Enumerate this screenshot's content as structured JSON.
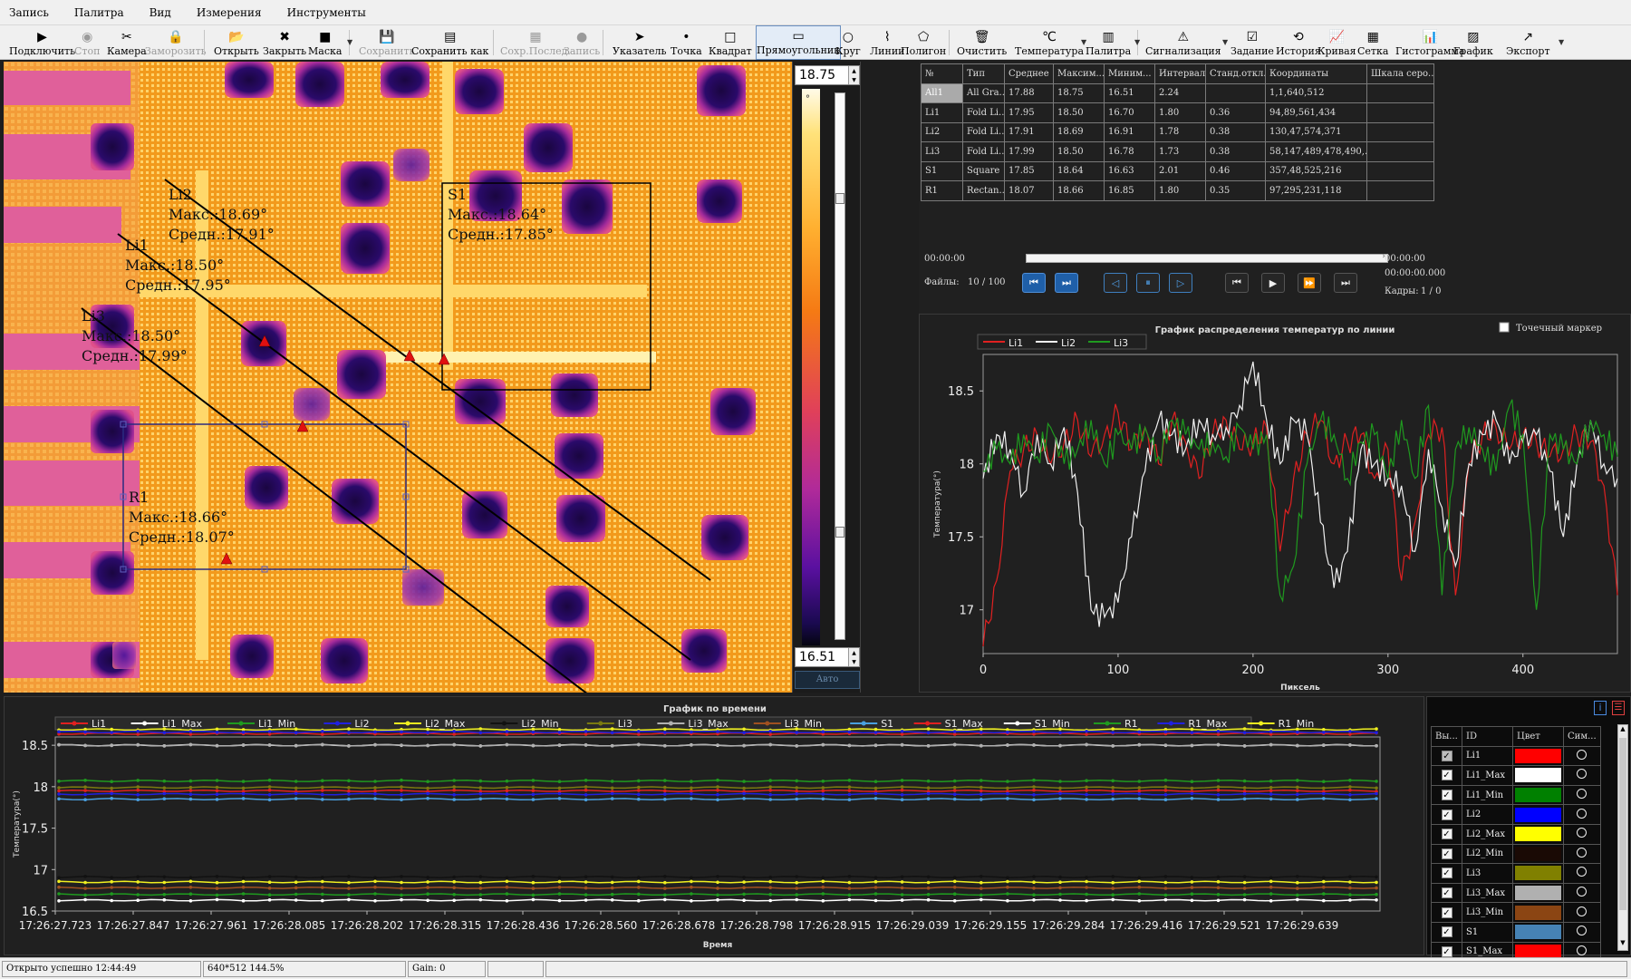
{
  "menu": [
    "Запись",
    "Палитра",
    "Вид",
    "Измерения",
    "Инструменты"
  ],
  "toolbar": [
    {
      "label": "Подключить",
      "icon": "play-icon",
      "glyph": "▶",
      "disabled": false
    },
    {
      "label": "Стоп",
      "icon": "stop-icon",
      "glyph": "◉",
      "disabled": true
    },
    {
      "label": "Камера",
      "icon": "camera-tools-icon",
      "glyph": "✂",
      "disabled": false
    },
    {
      "label": "Заморозить",
      "icon": "lock-icon",
      "glyph": "🔒",
      "disabled": true
    },
    {
      "label": "Открыть",
      "icon": "folder-icon",
      "glyph": "📂",
      "disabled": false
    },
    {
      "label": "Закрыть",
      "icon": "close-circle-icon",
      "glyph": "✖",
      "disabled": false
    },
    {
      "label": "Маска",
      "icon": "mask-icon",
      "glyph": "■",
      "disabled": false
    },
    {
      "label": "Сохранить",
      "icon": "save-icon",
      "glyph": "💾",
      "disabled": true
    },
    {
      "label": "Сохранить как",
      "icon": "save-as-icon",
      "glyph": "▤",
      "disabled": false
    },
    {
      "label": "Сохр.Послед.",
      "icon": "save-last-icon",
      "glyph": "▦",
      "disabled": true
    },
    {
      "label": "Запись",
      "icon": "record-icon",
      "glyph": "●",
      "disabled": true
    },
    {
      "label": "Указатель",
      "icon": "pointer-icon",
      "glyph": "➤",
      "disabled": false
    },
    {
      "label": "Точка",
      "icon": "point-icon",
      "glyph": "•",
      "disabled": false
    },
    {
      "label": "Квадрат",
      "icon": "square-icon",
      "glyph": "□",
      "disabled": false
    },
    {
      "label": "Прямоугольник",
      "icon": "rectangle-icon",
      "glyph": "▭",
      "disabled": false
    },
    {
      "label": "Круг",
      "icon": "circle-icon",
      "glyph": "○",
      "disabled": false
    },
    {
      "label": "Линии",
      "icon": "polyline-icon",
      "glyph": "⌇",
      "disabled": false
    },
    {
      "label": "Полигон",
      "icon": "polygon-icon",
      "glyph": "⬠",
      "disabled": false
    },
    {
      "label": "Очистить",
      "icon": "trash-icon",
      "glyph": "🗑",
      "disabled": false
    },
    {
      "label": "Температура",
      "icon": "celsius-icon",
      "glyph": "℃",
      "disabled": false
    },
    {
      "label": "Палитра",
      "icon": "palette-icon",
      "glyph": "▥",
      "disabled": false
    },
    {
      "label": "Сигнализация",
      "icon": "alarm-icon",
      "glyph": "⚠",
      "disabled": false
    },
    {
      "label": "Задание",
      "icon": "task-icon",
      "glyph": "☑",
      "disabled": false
    },
    {
      "label": "История",
      "icon": "history-icon",
      "glyph": "⟲",
      "disabled": false
    },
    {
      "label": "Кривая",
      "icon": "curve-icon",
      "glyph": "📈",
      "disabled": false
    },
    {
      "label": "Сетка",
      "icon": "grid-icon",
      "glyph": "▦",
      "disabled": false
    },
    {
      "label": "Гистограмма",
      "icon": "histogram-icon",
      "glyph": "📊",
      "disabled": false
    },
    {
      "label": "График",
      "icon": "graph-icon",
      "glyph": "▨",
      "disabled": false
    },
    {
      "label": "Экспорт",
      "icon": "export-icon",
      "glyph": "↗",
      "disabled": false
    }
  ],
  "thermal": {
    "annotations": [
      {
        "id": "Li2",
        "max": "Макс.:18.69°",
        "avg": "Средн.:17.91°"
      },
      {
        "id": "Li1",
        "max": "Макс.:18.50°",
        "avg": "Средн.:17.95°"
      },
      {
        "id": "Li3",
        "max": "Макс.:18.50°",
        "avg": "Средн.:17.99°"
      },
      {
        "id": "S1",
        "max": "Макс.:18.64°",
        "avg": "Средн.:17.85°"
      },
      {
        "id": "R1",
        "max": "Макс.:18.66°",
        "avg": "Средн.:18.07°"
      }
    ]
  },
  "colorbar": {
    "max": "18.75",
    "min": "16.51",
    "auto_label": "Авто",
    "marker": "°"
  },
  "table": {
    "headers": [
      "№",
      "Тип",
      "Среднее",
      "Максим...",
      "Миним...",
      "Интервал",
      "Станд.откл.",
      "Координаты",
      "Шкала серо..."
    ],
    "rows": [
      [
        "All1",
        "All Gra...",
        "17.88",
        "18.75",
        "16.51",
        "2.24",
        "",
        "1,1,640,512",
        ""
      ],
      [
        "Li1",
        "Fold Li...",
        "17.95",
        "18.50",
        "16.70",
        "1.80",
        "0.36",
        "94,89,561,434",
        ""
      ],
      [
        "Li2",
        "Fold Li...",
        "17.91",
        "18.69",
        "16.91",
        "1.78",
        "0.38",
        "130,47,574,371",
        ""
      ],
      [
        "Li3",
        "Fold Li...",
        "17.99",
        "18.50",
        "16.78",
        "1.73",
        "0.38",
        "58,147,489,478,490,...",
        ""
      ],
      [
        "S1",
        "Square",
        "17.85",
        "18.64",
        "16.63",
        "2.01",
        "0.46",
        "357,48,525,216",
        ""
      ],
      [
        "R1",
        "Rectan...",
        "18.07",
        "18.66",
        "16.85",
        "1.80",
        "0.35",
        "97,295,231,118",
        ""
      ]
    ]
  },
  "player": {
    "time_start": "00:00:00",
    "time_end": "00:00:00",
    "time_ms": "00:00:00.000",
    "files_label": "Файлы:",
    "files_value": "10 / 100",
    "frames_label": "Кадры:",
    "frames_value": "1 / 0",
    "progress": 0
  },
  "line_chart": {
    "title": "График распределения температур по линии",
    "marker_checkbox": "Точечный маркер",
    "ylabel": "Температура(°)",
    "xlabel": "Пиксель"
  },
  "time_chart": {
    "title": "График по времени",
    "ylabel": "Температура(°)",
    "xlabel": "Время"
  },
  "chart_data": [
    {
      "type": "line",
      "title": "График распределения температур по линии",
      "xlabel": "Пиксель",
      "ylabel": "Температура(°)",
      "xlim": [
        0,
        470
      ],
      "ylim": [
        16.7,
        18.75
      ],
      "xticks": [
        0,
        100,
        200,
        300,
        400
      ],
      "yticks": [
        17.0,
        17.5,
        18.0,
        18.5
      ],
      "legend": "top-left",
      "series": [
        {
          "name": "Li1",
          "color": "#e02020",
          "x": [
            0,
            10,
            20,
            30,
            40,
            50,
            60,
            70,
            80,
            90,
            100,
            110,
            120,
            130,
            140,
            150,
            160,
            170,
            180,
            190,
            200,
            210,
            220,
            230,
            240,
            250,
            260,
            270,
            280,
            290,
            300,
            310,
            320,
            330,
            340,
            350,
            360,
            370,
            380,
            390,
            400,
            410,
            420,
            430,
            440,
            450,
            460,
            470
          ],
          "values": [
            16.75,
            17.2,
            17.95,
            18.1,
            18.2,
            18.0,
            18.15,
            18.3,
            18.05,
            18.2,
            18.35,
            18.1,
            18.25,
            18.0,
            18.3,
            18.15,
            17.9,
            18.2,
            18.3,
            18.1,
            18.15,
            18.25,
            17.4,
            17.9,
            18.2,
            18.3,
            18.0,
            18.15,
            18.2,
            17.9,
            18.1,
            17.2,
            17.6,
            18.2,
            18.25,
            17.1,
            18.0,
            18.2,
            18.25,
            18.1,
            18.2,
            18.15,
            18.05,
            18.1,
            18.2,
            18.15,
            17.85,
            17.1
          ]
        },
        {
          "name": "Li2",
          "color": "#f0f0f0",
          "x": [
            0,
            10,
            20,
            30,
            40,
            50,
            60,
            70,
            80,
            90,
            100,
            110,
            120,
            130,
            140,
            150,
            160,
            170,
            180,
            190,
            200,
            210,
            220,
            230,
            240,
            250,
            260,
            270,
            280,
            290,
            300,
            310,
            320,
            330,
            340,
            350,
            360,
            370,
            380,
            390,
            400,
            410,
            420,
            430,
            440,
            450,
            460,
            470
          ],
          "values": [
            17.9,
            18.2,
            18.1,
            17.8,
            18.2,
            18.0,
            18.25,
            17.8,
            17.0,
            16.95,
            17.05,
            17.5,
            17.95,
            18.3,
            18.2,
            18.1,
            18.3,
            18.2,
            18.25,
            18.4,
            18.7,
            18.3,
            18.0,
            18.3,
            18.2,
            17.6,
            17.15,
            17.4,
            18.1,
            18.0,
            17.9,
            17.85,
            17.4,
            18.1,
            17.7,
            17.3,
            18.0,
            18.2,
            18.3,
            18.0,
            18.15,
            18.2,
            17.95,
            17.5,
            18.0,
            18.3,
            18.0,
            17.9
          ]
        },
        {
          "name": "Li3",
          "color": "#1f9a1f",
          "x": [
            0,
            10,
            20,
            30,
            40,
            50,
            60,
            70,
            80,
            90,
            100,
            110,
            120,
            130,
            140,
            150,
            160,
            170,
            180,
            190,
            200,
            210,
            220,
            230,
            240,
            250,
            260,
            270,
            280,
            290,
            300,
            310,
            320,
            330,
            340,
            350,
            360,
            370,
            380,
            390,
            400,
            410,
            420,
            430,
            440,
            450,
            460,
            470
          ],
          "values": [
            17.95,
            18.1,
            18.0,
            18.2,
            18.05,
            18.25,
            18.0,
            18.1,
            18.3,
            18.0,
            18.2,
            18.1,
            18.25,
            18.05,
            18.3,
            18.2,
            18.1,
            18.15,
            18.05,
            18.25,
            18.1,
            18.2,
            17.1,
            17.3,
            18.0,
            18.3,
            18.2,
            17.9,
            18.15,
            18.2,
            17.9,
            18.3,
            17.9,
            18.4,
            17.1,
            18.1,
            18.25,
            18.1,
            17.95,
            18.4,
            18.2,
            17.0,
            18.2,
            18.1,
            18.0,
            18.3,
            18.2,
            18.05
          ]
        }
      ]
    },
    {
      "type": "line",
      "title": "График по времени",
      "xlabel": "Время",
      "ylabel": "Температура(°)",
      "ylim": [
        16.5,
        18.6
      ],
      "yticks": [
        16.5,
        17.0,
        17.5,
        18.0,
        18.5
      ],
      "categories": [
        "17:26:27.723",
        "17:26:27.847",
        "17:26:27.961",
        "17:26:28.085",
        "17:26:28.202",
        "17:26:28.315",
        "17:26:28.436",
        "17:26:28.560",
        "17:26:28.678",
        "17:26:28.798",
        "17:26:28.915",
        "17:26:29.039",
        "17:26:29.155",
        "17:26:29.284",
        "17:26:29.416",
        "17:26:29.521",
        "17:26:29.639"
      ],
      "legend": "top",
      "series": [
        {
          "name": "Li1",
          "color": "#e02020",
          "value": 17.95
        },
        {
          "name": "Li1_Max",
          "color": "#ffffff",
          "value": 18.5
        },
        {
          "name": "Li1_Min",
          "color": "#1f9a1f",
          "value": 16.7
        },
        {
          "name": "Li2",
          "color": "#2020e0",
          "value": 17.91
        },
        {
          "name": "Li2_Max",
          "color": "#f0f020",
          "value": 18.69
        },
        {
          "name": "Li2_Min",
          "color": "#111111",
          "value": 16.91
        },
        {
          "name": "Li3",
          "color": "#7a7a10",
          "value": 17.99
        },
        {
          "name": "Li3_Max",
          "color": "#b0b0b0",
          "value": 18.5
        },
        {
          "name": "Li3_Min",
          "color": "#a05020",
          "value": 16.78
        },
        {
          "name": "S1",
          "color": "#4aa0e0",
          "value": 17.85
        },
        {
          "name": "S1_Max",
          "color": "#e02020",
          "value": 18.64
        },
        {
          "name": "S1_Min",
          "color": "#ffffff",
          "value": 16.63
        },
        {
          "name": "R1",
          "color": "#1f9a1f",
          "value": 18.07
        },
        {
          "name": "R1_Max",
          "color": "#2020e0",
          "value": 18.66
        },
        {
          "name": "R1_Min",
          "color": "#f0f020",
          "value": 16.85
        }
      ]
    }
  ],
  "series_table": {
    "headers": [
      "Вы...",
      "ID",
      "Цвет",
      "Сим..."
    ],
    "rows": [
      {
        "id": "Li1",
        "color": "#ff0000"
      },
      {
        "id": "Li1_Max",
        "color": "#ffffff"
      },
      {
        "id": "Li1_Min",
        "color": "#008000"
      },
      {
        "id": "Li2",
        "color": "#0000ff"
      },
      {
        "id": "Li2_Max",
        "color": "#ffff00"
      },
      {
        "id": "Li2_Min",
        "color": "#1a0a05"
      },
      {
        "id": "Li3",
        "color": "#808000"
      },
      {
        "id": "Li3_Max",
        "color": "#b0b0b0"
      },
      {
        "id": "Li3_Min",
        "color": "#8b4513"
      },
      {
        "id": "S1",
        "color": "#4682b4"
      },
      {
        "id": "S1_Max",
        "color": "#ff0000"
      }
    ]
  },
  "status": {
    "message": "Открыто успешно 12:44:49",
    "resolution": "640*512 144.5%",
    "gain": "Gain: 0"
  }
}
